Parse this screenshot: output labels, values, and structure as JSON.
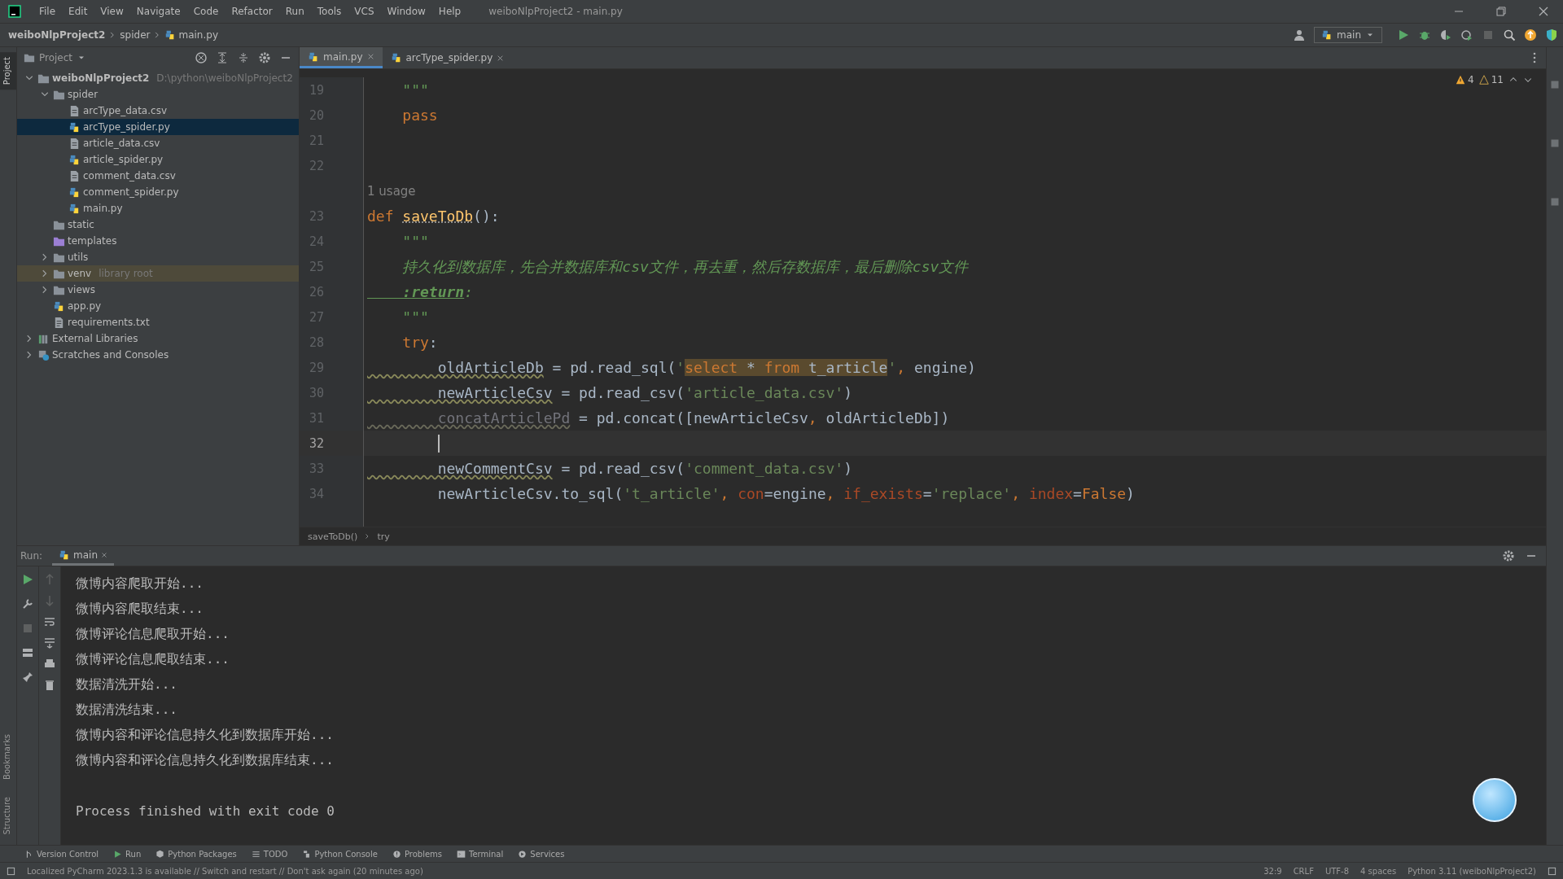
{
  "menu_bar": {
    "items": [
      "File",
      "Edit",
      "View",
      "Navigate",
      "Code",
      "Refactor",
      "Run",
      "Tools",
      "VCS",
      "Window",
      "Help"
    ],
    "title": "weiboNlpProject2 - main.py"
  },
  "navigation_bar": {
    "breadcrumbs": [
      {
        "text": "weiboNlpProject2",
        "kind": "project"
      },
      {
        "text": "spider",
        "kind": "folder"
      },
      {
        "text": "main.py",
        "kind": "py"
      }
    ],
    "run_config": "main"
  },
  "left_strip": {
    "top": [
      {
        "label": "Project",
        "selected": true
      }
    ],
    "bottom": [
      {
        "label": "Bookmarks",
        "selected": false
      },
      {
        "label": "Structure",
        "selected": false
      }
    ]
  },
  "project_panel": {
    "title": "Project",
    "tree": [
      {
        "name": "weiboNlpProject2",
        "path": "D:\\python\\weiboNlpProject2",
        "kind": "root",
        "expanded": true,
        "selected": false,
        "children": [
          {
            "name": "spider",
            "kind": "folder",
            "expanded": true,
            "selected": false,
            "children": [
              {
                "name": "arcType_data.csv",
                "kind": "csv",
                "selected": false
              },
              {
                "name": "arcType_spider.py",
                "kind": "py",
                "selected": true
              },
              {
                "name": "article_data.csv",
                "kind": "csv",
                "selected": false
              },
              {
                "name": "article_spider.py",
                "kind": "py",
                "selected": false
              },
              {
                "name": "comment_data.csv",
                "kind": "csv",
                "selected": false
              },
              {
                "name": "comment_spider.py",
                "kind": "py",
                "selected": false
              },
              {
                "name": "main.py",
                "kind": "py",
                "selected": false
              }
            ]
          },
          {
            "name": "static",
            "kind": "folder",
            "selected": false
          },
          {
            "name": "templates",
            "kind": "templates",
            "selected": false
          },
          {
            "name": "utils",
            "kind": "folder",
            "expanded": false,
            "selected": false
          },
          {
            "name": "venv",
            "path": "library root",
            "kind": "venv",
            "expanded": false,
            "selected": false
          },
          {
            "name": "views",
            "kind": "folder",
            "expanded": false,
            "selected": false
          },
          {
            "name": "app.py",
            "kind": "py",
            "selected": false
          },
          {
            "name": "requirements.txt",
            "kind": "txt",
            "selected": false
          }
        ]
      },
      {
        "name": "External Libraries",
        "kind": "library",
        "expanded": false,
        "selected": false
      },
      {
        "name": "Scratches and Consoles",
        "kind": "scratches",
        "expanded": false,
        "selected": false
      }
    ]
  },
  "editor": {
    "tabs": [
      {
        "label": "main.py",
        "selected": true
      },
      {
        "label": "arcType_spider.py",
        "selected": false
      }
    ],
    "inspections": {
      "warnings": "4",
      "weak_warnings": "11"
    },
    "lines": [
      {
        "kind": "code",
        "number": "19",
        "current": false,
        "tokens": [
          {
            "text": "    \"\"\"",
            "kind": "doc"
          }
        ]
      },
      {
        "kind": "code",
        "number": "20",
        "current": false,
        "tokens": [
          {
            "text": "    pass",
            "kind": "kw"
          }
        ]
      },
      {
        "kind": "code",
        "number": "21",
        "current": false
      },
      {
        "kind": "code",
        "number": "22",
        "current": false
      },
      {
        "kind": "hint",
        "text": "1 usage"
      },
      {
        "kind": "code",
        "number": "23",
        "current": false,
        "tokens": [
          {
            "text": "def ",
            "kind": "kw"
          },
          {
            "text": "saveToDb",
            "kind": "fn"
          },
          {
            "text": "():",
            "kind": "plain"
          }
        ]
      },
      {
        "kind": "code",
        "number": "24",
        "current": false,
        "tokens": [
          {
            "text": "    \"\"\"",
            "kind": "doc"
          }
        ]
      },
      {
        "kind": "code",
        "number": "25",
        "current": false,
        "tokens": [
          {
            "text": "    持久化到数据库，先合并数据库和csv文件，再去重，然后存数据库，最后删除csv文件",
            "kind": "doc"
          }
        ]
      },
      {
        "kind": "code",
        "number": "26",
        "current": false,
        "tokens": [
          {
            "text": "    :return",
            "kind": "doctag"
          },
          {
            "text": ":",
            "kind": "doc"
          }
        ]
      },
      {
        "kind": "code",
        "number": "27",
        "current": false,
        "tokens": [
          {
            "text": "    \"\"\"",
            "kind": "doc"
          }
        ]
      },
      {
        "kind": "code",
        "number": "28",
        "current": false,
        "tokens": [
          {
            "text": "    try",
            "kind": "kw"
          },
          {
            "text": ":",
            "kind": "plain"
          }
        ]
      },
      {
        "kind": "code",
        "number": "29",
        "current": false,
        "tokens": [
          {
            "text": "        oldArticleDb",
            "kind": "var"
          },
          {
            "text": " = pd.read_sql(",
            "kind": "plain"
          },
          {
            "text": "'",
            "kind": "str"
          },
          {
            "text": "select",
            "kind": "sqlkw"
          },
          {
            "text": " * ",
            "kind": "sql"
          },
          {
            "text": "from",
            "kind": "sqlkw"
          },
          {
            "text": " t_article",
            "kind": "sql"
          },
          {
            "text": "'",
            "kind": "str"
          },
          {
            "text": ", ",
            "kind": "kw"
          },
          {
            "text": "engine)",
            "kind": "plain"
          }
        ]
      },
      {
        "kind": "code",
        "number": "30",
        "current": false,
        "tokens": [
          {
            "text": "        newArticleCsv",
            "kind": "var"
          },
          {
            "text": " = pd.read_csv(",
            "kind": "plain"
          },
          {
            "text": "'article_data.csv'",
            "kind": "str"
          },
          {
            "text": ")",
            "kind": "plain"
          }
        ]
      },
      {
        "kind": "code",
        "number": "31",
        "current": false,
        "tokens": [
          {
            "text": "        concatArticlePd",
            "kind": "unused"
          },
          {
            "text": " = pd.concat([newArticleCsv",
            "kind": "plain"
          },
          {
            "text": ", ",
            "kind": "kw"
          },
          {
            "text": "oldArticleDb])",
            "kind": "plain"
          }
        ]
      },
      {
        "kind": "code",
        "number": "32",
        "current": true
      },
      {
        "kind": "code",
        "number": "33",
        "current": false,
        "tokens": [
          {
            "text": "        newCommentCsv",
            "kind": "var"
          },
          {
            "text": " = pd.read_csv(",
            "kind": "plain"
          },
          {
            "text": "'comment_data.csv'",
            "kind": "str"
          },
          {
            "text": ")",
            "kind": "plain"
          }
        ]
      },
      {
        "kind": "code",
        "number": "34",
        "current": false,
        "tokens": [
          {
            "text": "        newArticleCsv.to_sql(",
            "kind": "plain"
          },
          {
            "text": "'t_article'",
            "kind": "str"
          },
          {
            "text": ", ",
            "kind": "kw"
          },
          {
            "text": "con",
            "kind": "named"
          },
          {
            "text": "=engine",
            "kind": "plain"
          },
          {
            "text": ", ",
            "kind": "kw"
          },
          {
            "text": "if_exists",
            "kind": "named"
          },
          {
            "text": "=",
            "kind": "plain"
          },
          {
            "text": "'replace'",
            "kind": "str"
          },
          {
            "text": ", ",
            "kind": "kw"
          },
          {
            "text": "index",
            "kind": "named"
          },
          {
            "text": "=",
            "kind": "plain"
          },
          {
            "text": "False",
            "kind": "kw"
          },
          {
            "text": ")",
            "kind": "plain"
          }
        ]
      }
    ],
    "breadcrumbs": [
      "saveToDb()",
      "try"
    ]
  },
  "run_panel": {
    "label": "Run:",
    "tab": "main",
    "output": [
      {
        "kind": "stdout",
        "text": "微博内容爬取开始..."
      },
      {
        "kind": "stdout",
        "text": "微博内容爬取结束..."
      },
      {
        "kind": "stdout",
        "text": "微博评论信息爬取开始..."
      },
      {
        "kind": "stdout",
        "text": "微博评论信息爬取结束..."
      },
      {
        "kind": "stdout",
        "text": "数据清洗开始..."
      },
      {
        "kind": "stdout",
        "text": "数据清洗结束..."
      },
      {
        "kind": "stdout",
        "text": "微博内容和评论信息持久化到数据库开始..."
      },
      {
        "kind": "stdout",
        "text": "微博内容和评论信息持久化到数据库结束..."
      },
      {
        "kind": "exit",
        "text": "Process finished with exit code 0"
      }
    ]
  },
  "tool_tabs": [
    "Version Control",
    "Run",
    "Python Packages",
    "TODO",
    "Python Console",
    "Problems",
    "Terminal",
    "Services"
  ],
  "status_bar": {
    "message": "Localized PyCharm 2023.1.3 is available // Switch and restart // Don't ask again (20 minutes ago)",
    "items": [
      "32:9",
      "CRLF",
      "UTF-8",
      "4 spaces",
      "Python 3.11 (weiboNlpProject2)"
    ]
  }
}
